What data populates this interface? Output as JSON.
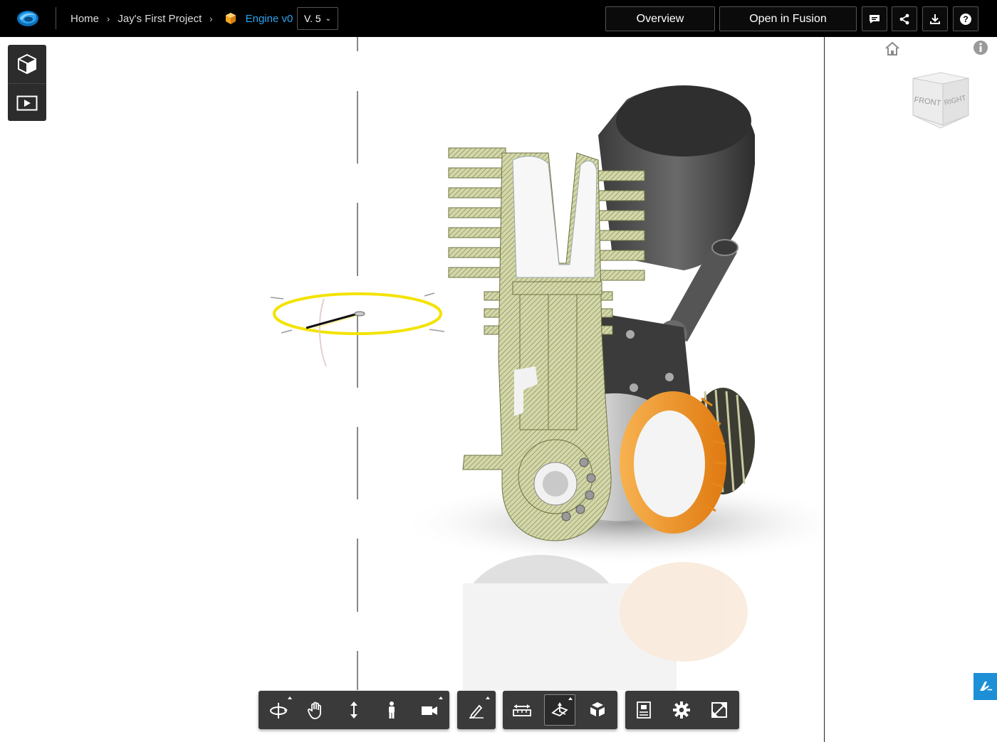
{
  "header": {
    "breadcrumbs": [
      "Home",
      "Jay's First Project"
    ],
    "active_item": "Engine v0",
    "version": "V. 5",
    "overview_label": "Overview",
    "open_in_fusion_label": "Open in Fusion"
  },
  "icons": {
    "logo": "autodesk-viewer-logo",
    "comments": "comment-icon",
    "share": "share-icon",
    "download": "download-icon",
    "help": "help-icon"
  },
  "viewcube": {
    "front_label": "FRONT",
    "right_label": "RIGHT"
  },
  "toolbar": {
    "groups": [
      [
        "orbit-tool",
        "pan-tool",
        "dolly-tool",
        "first-person-tool",
        "camera-tool"
      ],
      [
        "markup-tool"
      ],
      [
        "measure-tool",
        "section-analysis-tool",
        "explode-tool"
      ],
      [
        "model-browser-tool",
        "settings-tool",
        "fullscreen-tool"
      ]
    ],
    "selected": "section-analysis-tool"
  },
  "colors": {
    "topbar": "#000000",
    "accent": "#2aa3ef",
    "toolbar": "#3a3a3a",
    "section_fill": "#cfd3a4",
    "gear_orange": "#f59a2c",
    "gizmo_yellow": "#f3e300"
  }
}
